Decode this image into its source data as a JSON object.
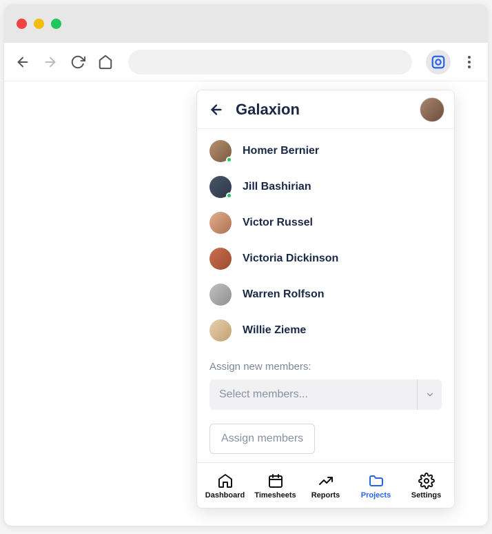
{
  "header": {
    "title": "Galaxion"
  },
  "members": [
    {
      "name": "Homer Bernier",
      "online": true,
      "avatar_bg": "linear-gradient(135deg,#b89070,#7a5a40)"
    },
    {
      "name": "Jill Bashirian",
      "online": true,
      "avatar_bg": "linear-gradient(135deg,#4a5568,#2d3748)"
    },
    {
      "name": "Victor Russel",
      "online": false,
      "avatar_bg": "linear-gradient(135deg,#e0b090,#b07050)"
    },
    {
      "name": "Victoria Dickinson",
      "online": false,
      "avatar_bg": "linear-gradient(135deg,#c97050,#9e4a30)"
    },
    {
      "name": "Warren Rolfson",
      "online": false,
      "avatar_bg": "linear-gradient(135deg,#c0c0c0,#909090)"
    },
    {
      "name": "Willie Zieme",
      "online": false,
      "avatar_bg": "linear-gradient(135deg,#e8d0b0,#c0a070)"
    }
  ],
  "assign": {
    "label": "Assign new members:",
    "select_placeholder": "Select members...",
    "button_label": "Assign members"
  },
  "bottom_nav": [
    {
      "label": "Dashboard",
      "icon": "home",
      "active": false
    },
    {
      "label": "Timesheets",
      "icon": "calendar",
      "active": false
    },
    {
      "label": "Reports",
      "icon": "trend",
      "active": false
    },
    {
      "label": "Projects",
      "icon": "folder",
      "active": true
    },
    {
      "label": "Settings",
      "icon": "gear",
      "active": false
    }
  ],
  "colors": {
    "accent": "#2563eb",
    "text_primary": "#1a2847"
  }
}
